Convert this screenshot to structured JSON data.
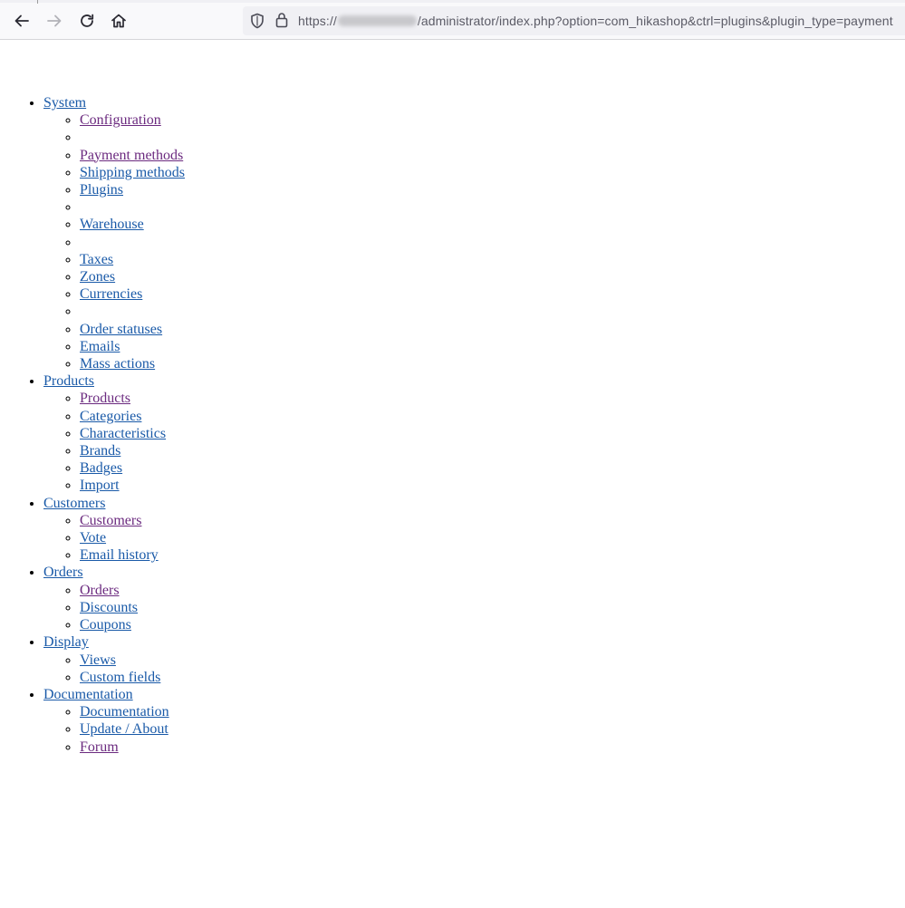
{
  "browser": {
    "url_prefix": "https://",
    "url_path": "/administrator/index.php?option=com_hikashop&ctrl=plugins&plugin_type=payment",
    "icons": {
      "back": "arrow-left-icon",
      "forward": "arrow-right-icon",
      "reload": "reload-icon",
      "home": "home-icon",
      "tracking": "shield-icon",
      "security": "lock-icon"
    }
  },
  "colors": {
    "link": "#1a5aa8",
    "visited": "#6b2a7f"
  },
  "menu": [
    {
      "label": "System",
      "items": [
        {
          "label": "Configuration",
          "visited": true
        },
        {
          "label": ""
        },
        {
          "label": "Payment methods",
          "visited": true
        },
        {
          "label": "Shipping methods"
        },
        {
          "label": "Plugins"
        },
        {
          "label": ""
        },
        {
          "label": "Warehouse"
        },
        {
          "label": ""
        },
        {
          "label": "Taxes"
        },
        {
          "label": "Zones"
        },
        {
          "label": "Currencies"
        },
        {
          "label": ""
        },
        {
          "label": "Order statuses"
        },
        {
          "label": "Emails"
        },
        {
          "label": "Mass actions"
        }
      ]
    },
    {
      "label": "Products",
      "items": [
        {
          "label": "Products",
          "visited": true
        },
        {
          "label": "Categories"
        },
        {
          "label": "Characteristics"
        },
        {
          "label": "Brands"
        },
        {
          "label": "Badges"
        },
        {
          "label": "Import"
        }
      ]
    },
    {
      "label": "Customers",
      "items": [
        {
          "label": "Customers",
          "visited": true
        },
        {
          "label": "Vote"
        },
        {
          "label": "Email history"
        }
      ]
    },
    {
      "label": "Orders",
      "items": [
        {
          "label": "Orders",
          "visited": true
        },
        {
          "label": "Discounts"
        },
        {
          "label": "Coupons"
        }
      ]
    },
    {
      "label": "Display",
      "items": [
        {
          "label": "Views"
        },
        {
          "label": "Custom fields"
        }
      ]
    },
    {
      "label": "Documentation",
      "items": [
        {
          "label": "Documentation"
        },
        {
          "label": "Update / About"
        },
        {
          "label": "Forum",
          "visited": true
        }
      ]
    }
  ]
}
